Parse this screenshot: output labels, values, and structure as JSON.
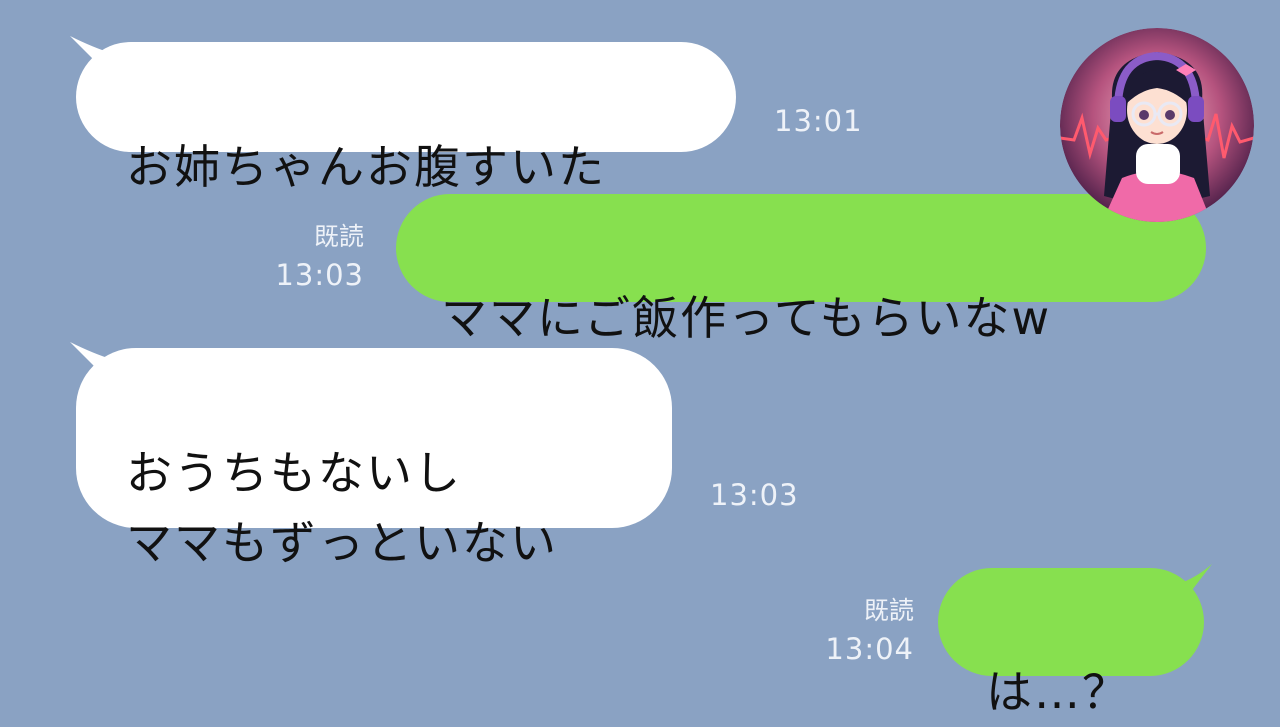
{
  "chat": {
    "messages": [
      {
        "side": "in",
        "text": "お姉ちゃんお腹すいた",
        "time": "13:01"
      },
      {
        "side": "out",
        "text": "ママにご飯作ってもらいなw",
        "read": "既読",
        "time": "13:03"
      },
      {
        "side": "in",
        "text": "おうちもないし\nママもずっといない",
        "time": "13:03"
      },
      {
        "side": "out",
        "text": "は…？",
        "read": "既読",
        "time": "13:04"
      }
    ]
  },
  "colors": {
    "background": "#8aa2c3",
    "incoming_bubble": "#ffffff",
    "outgoing_bubble": "#87e04f"
  },
  "avatar": {
    "icon": "girl-with-headphones-avatar"
  }
}
